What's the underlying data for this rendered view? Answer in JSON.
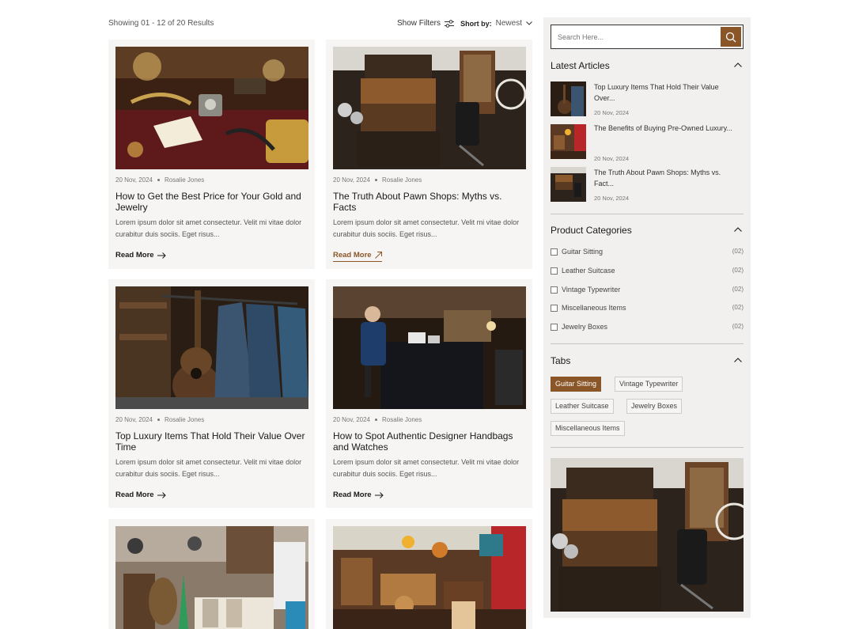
{
  "toolbar": {
    "results_text": "Showing 01 - 12 of 20 Results",
    "filters_label": "Show Filters",
    "sort_label": "Short by:",
    "sort_value": "Newest"
  },
  "posts": [
    {
      "date": "20 Nov, 2024",
      "author": "Rosalie Jones",
      "title": "How to Get the Best Price for Your Gold and Jewelry",
      "excerpt": "Lorem ipsum dolor sit amet consectetur. Velit mi vitae dolor curabitur duis sociis. Eget risus...",
      "read_more": "Read More"
    },
    {
      "date": "20 Nov, 2024",
      "author": "Rosalie Jones",
      "title": "The Truth About Pawn Shops: Myths vs. Facts",
      "excerpt": "Lorem ipsum dolor sit amet consectetur. Velit mi vitae dolor curabitur duis sociis. Eget risus...",
      "read_more": "Read More"
    },
    {
      "date": "20 Nov, 2024",
      "author": "Rosalie Jones",
      "title": "Top Luxury Items That Hold Their Value Over Time",
      "excerpt": "Lorem ipsum dolor sit amet consectetur. Velit mi vitae dolor curabitur duis sociis. Eget risus...",
      "read_more": "Read More"
    },
    {
      "date": "20 Nov, 2024",
      "author": "Rosalie Jones",
      "title": "How to Spot Authentic Designer Handbags and Watches",
      "excerpt": "Lorem ipsum dolor sit amet consectetur. Velit mi vitae dolor curabitur duis sociis. Eget risus...",
      "read_more": "Read More"
    }
  ],
  "sidebar": {
    "search_placeholder": "Search Here...",
    "latest_title": "Latest Articles",
    "articles": [
      {
        "title": "Top Luxury Items That Hold Their Value Over...",
        "date": "20 Nov, 2024"
      },
      {
        "title": "The Benefits of Buying Pre-Owned Luxury...",
        "date": "20 Nov, 2024"
      },
      {
        "title": "The Truth About Pawn Shops: Myths vs. Fact...",
        "date": "20 Nov, 2024"
      }
    ],
    "categories_title": "Product Categories",
    "categories": [
      {
        "name": "Guitar Sitting",
        "count": "(02)"
      },
      {
        "name": "Leather Suitcase",
        "count": "(02)"
      },
      {
        "name": "Vintage Typewriter",
        "count": "(02)"
      },
      {
        "name": "Miscellaneous Items",
        "count": "(02)"
      },
      {
        "name": "Jewelry Boxes",
        "count": "(02)"
      }
    ],
    "tabs_title": "Tabs",
    "tags": [
      "Guitar Sitting",
      "Vintage Typewriter",
      "Leather Suitcase",
      "Jewelry Boxes",
      "Miscellaneous Items"
    ]
  },
  "colors": {
    "accent": "#8a5628",
    "card_bg": "#f6f5f3",
    "sidebar_bg": "#f1f0ee"
  },
  "icons": {
    "filters": "sliders-icon",
    "sort": "chevron-down-icon",
    "search": "search-icon",
    "read_more": "arrow-right-icon",
    "section": "chevron-up-icon"
  }
}
